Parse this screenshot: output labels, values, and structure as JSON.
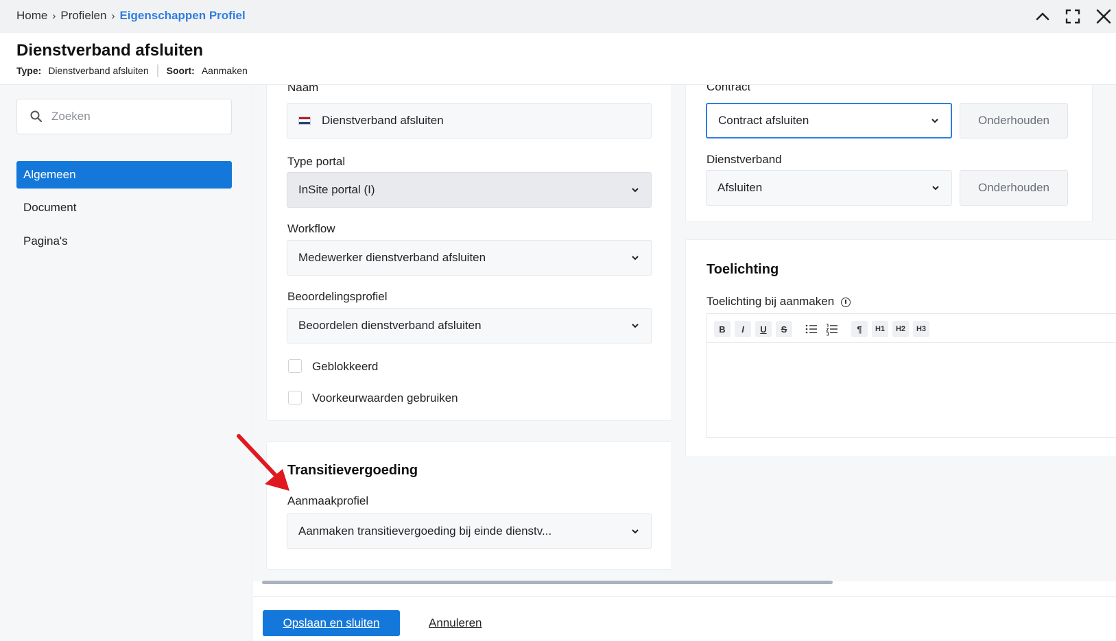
{
  "breadcrumb": {
    "items": [
      "Home",
      "Profielen"
    ],
    "current": "Eigenschappen Profiel",
    "separator": "›"
  },
  "window_controls": [
    "chevron-up-icon",
    "expand-icon",
    "close-icon"
  ],
  "header": {
    "title": "Dienstverband afsluiten",
    "type_label": "Type:",
    "type_value": "Dienstverband afsluiten",
    "soort_label": "Soort:",
    "soort_value": "Aanmaken"
  },
  "sidebar": {
    "search_placeholder": "Zoeken",
    "items": [
      {
        "label": "Algemeen",
        "active": true
      },
      {
        "label": "Document",
        "active": false
      },
      {
        "label": "Pagina's",
        "active": false
      }
    ]
  },
  "general": {
    "naam_label": "Naam",
    "naam_value": "Dienstverband afsluiten",
    "type_portal_label": "Type portal",
    "type_portal_value": "InSite portal (I)",
    "workflow_label": "Workflow",
    "workflow_value": "Medewerker dienstverband afsluiten",
    "beoordelingsprofiel_label": "Beoordelingsprofiel",
    "beoordelingsprofiel_value": "Beoordelen dienstverband afsluiten",
    "geblokkeerd_label": "Geblokkeerd",
    "voorkeur_label": "Voorkeurwaarden gebruiken"
  },
  "transitie": {
    "title": "Transitievergoeding",
    "aanmaakprofiel_label": "Aanmaakprofiel",
    "aanmaakprofiel_value": "Aanmaken transitievergoeding bij einde dienstv..."
  },
  "contract": {
    "contract_label": "Contract",
    "contract_value": "Contract afsluiten",
    "contract_button": "Onderhouden",
    "dienstverband_label": "Dienstverband",
    "dienstverband_value": "Afsluiten",
    "dienstverband_button": "Onderhouden"
  },
  "toelichting": {
    "title": "Toelichting",
    "field_label": "Toelichting bij aanmaken",
    "toolbar": {
      "bold": "B",
      "italic": "I",
      "underline": "U",
      "strike": "S",
      "paragraph": "¶",
      "h1": "H1",
      "h2": "H2",
      "h3": "H3"
    }
  },
  "footer": {
    "save_label": "Opslaan en sluiten",
    "cancel_label": "Annuleren"
  },
  "colors": {
    "accent": "#1478db",
    "breadcrumb_current": "#2f7de1",
    "annotation_arrow": "#e0191e"
  }
}
